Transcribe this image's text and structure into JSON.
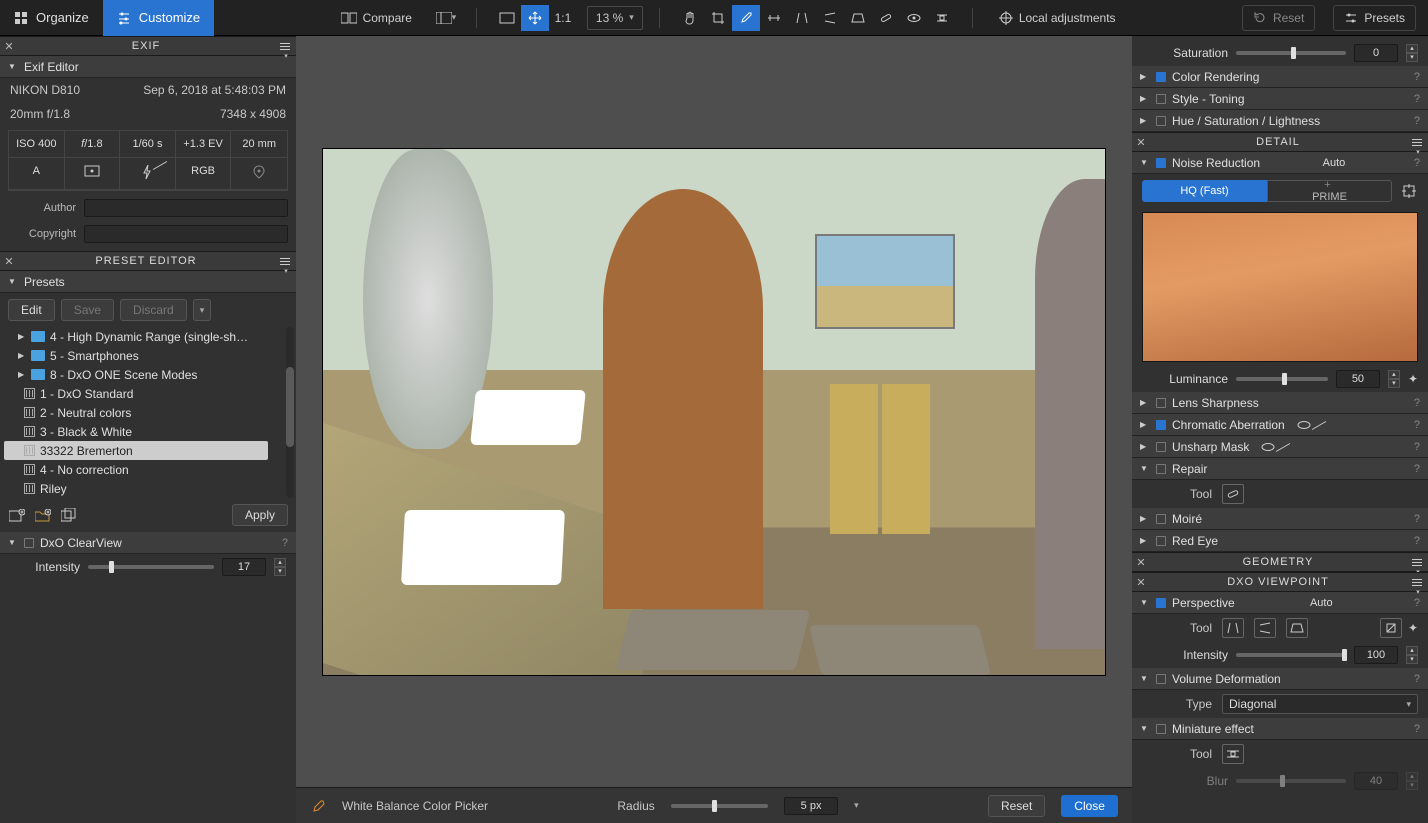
{
  "topbar": {
    "organize": "Organize",
    "customize": "Customize",
    "compare": "Compare",
    "one_to_one": "1:1",
    "zoom_pct": "13 %",
    "local_adj": "Local adjustments",
    "reset": "Reset",
    "presets": "Presets"
  },
  "exif": {
    "header": "EXIF",
    "section": "Exif Editor",
    "camera": "NIKON D810",
    "date": "Sep 6, 2018 at 5:48:03 PM",
    "lens": "20mm f/1.8",
    "dims": "7348 x 4908",
    "grid": [
      "ISO 400",
      "f/1.8",
      "1/60 s",
      "+1.3 EV",
      "20 mm",
      "A",
      "[•]",
      "⚡",
      "RGB",
      "📍"
    ],
    "author_lab": "Author",
    "copyright_lab": "Copyright"
  },
  "preset": {
    "header": "PRESET EDITOR",
    "section": "Presets",
    "edit": "Edit",
    "save": "Save",
    "discard": "Discard",
    "apply": "Apply",
    "folders": [
      "4 - High Dynamic Range (single-sh…",
      "5 - Smartphones",
      "8 - DxO ONE Scene Modes"
    ],
    "items": [
      "1 - DxO Standard",
      "2 - Neutral colors",
      "3 - Black & White",
      "33322 Bremerton",
      "4 - No correction",
      "Riley"
    ],
    "selected_index": 3
  },
  "clearview": {
    "title": "DxO ClearView",
    "intensity_lab": "Intensity",
    "intensity_val": "17"
  },
  "bottom": {
    "picker": "White Balance Color Picker",
    "radius_lab": "Radius",
    "radius_val": "5 px",
    "reset": "Reset",
    "close": "Close"
  },
  "right_top": {
    "sat_lab": "Saturation",
    "sat_val": "0",
    "color_rendering": "Color Rendering",
    "style_toning": "Style - Toning",
    "hsl": "Hue / Saturation / Lightness"
  },
  "detail": {
    "header": "DETAIL",
    "nr_title": "Noise Reduction",
    "nr_auto": "Auto",
    "hq": "HQ (Fast)",
    "prime": "PRIME",
    "lum_lab": "Luminance",
    "lum_val": "50",
    "lens_sharp": "Lens Sharpness",
    "ca": "Chromatic Aberration",
    "unsharp": "Unsharp Mask",
    "repair": "Repair",
    "repair_lab": "Tool",
    "moire": "Moiré",
    "redeye": "Red Eye"
  },
  "geometry": {
    "header": "GEOMETRY"
  },
  "viewpoint": {
    "header": "DXO VIEWPOINT",
    "perspective": "Perspective",
    "auto": "Auto",
    "tool_lab": "Tool",
    "intensity_lab": "Intensity",
    "intensity_val": "100",
    "vol_def": "Volume Deformation",
    "type_lab": "Type",
    "type_val": "Diagonal",
    "mini": "Miniature effect",
    "mini_tool": "Tool",
    "blur_lab": "Blur",
    "blur_val": "40"
  }
}
